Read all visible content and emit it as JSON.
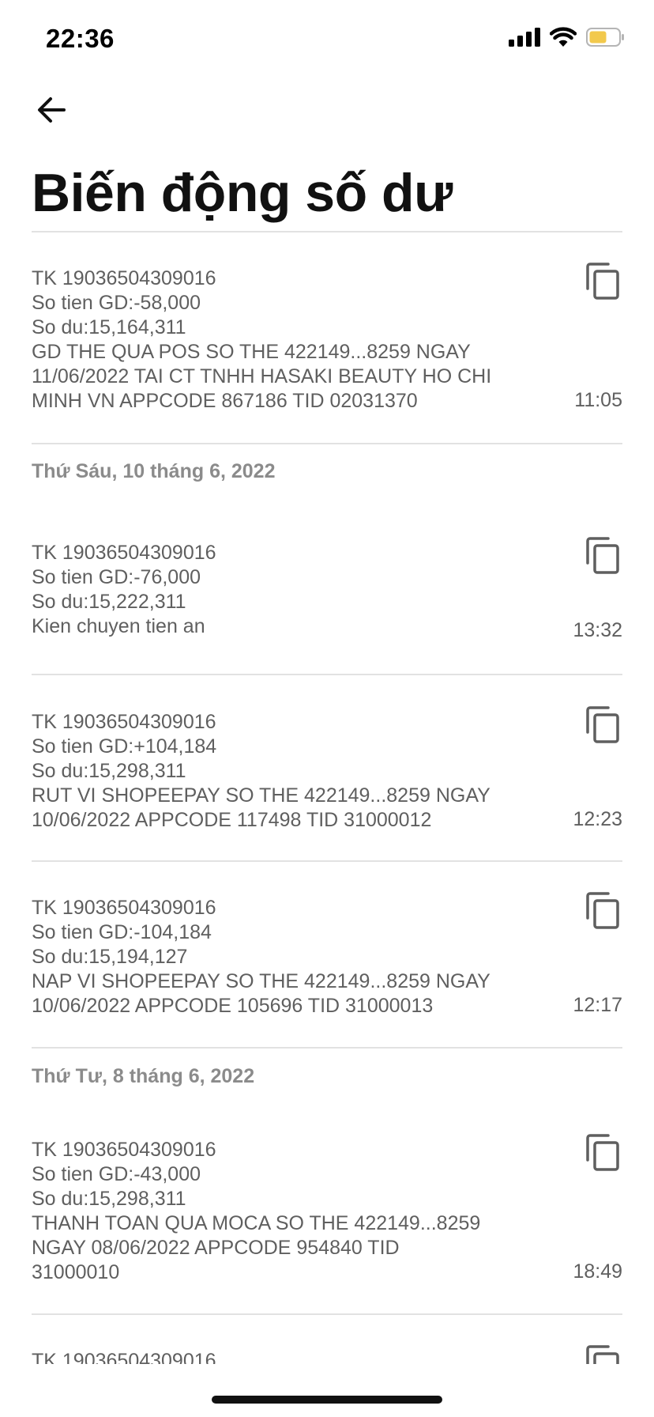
{
  "status_bar": {
    "time": "22:36",
    "battery_color": "#f2c94c"
  },
  "nav": {
    "back_icon": "arrow-left-icon"
  },
  "page": {
    "title": "Biến động số dư"
  },
  "colors": {
    "text": "#5f5f5f",
    "header": "#8b8b8b",
    "divider": "#e2e2e2"
  },
  "transactions": [
    {
      "lines": [
        "TK 19036504309016",
        "So tien GD:-58,000",
        "So du:15,164,311",
        "GD THE QUA POS SO THE 422149...8259 NGAY",
        "11/06/2022 TAI CT TNHH HASAKI BEAUTY HO CHI",
        "MINH VN APPCODE 867186 TID 02031370"
      ],
      "time": "11:05"
    },
    {
      "date_header": "Thứ Sáu, 10 tháng 6, 2022",
      "lines": [
        "TK 19036504309016",
        "So tien GD:-76,000",
        "So du:15,222,311",
        "Kien chuyen tien an"
      ],
      "time": "13:32"
    },
    {
      "lines": [
        "TK 19036504309016",
        "So tien GD:+104,184",
        "So du:15,298,311",
        "RUT VI SHOPEEPAY SO THE 422149...8259 NGAY",
        "10/06/2022 APPCODE 117498 TID 31000012"
      ],
      "time": "12:23"
    },
    {
      "lines": [
        "TK 19036504309016",
        "So tien GD:-104,184",
        "So du:15,194,127",
        "NAP VI SHOPEEPAY SO THE 422149...8259 NGAY",
        "10/06/2022 APPCODE 105696 TID 31000013"
      ],
      "time": "12:17"
    },
    {
      "date_header": "Thứ Tư, 8 tháng 6, 2022",
      "lines": [
        "TK 19036504309016",
        "So tien GD:-43,000",
        "So du:15,298,311",
        "THANH TOAN QUA MOCA SO THE 422149...8259",
        "NGAY 08/06/2022 APPCODE 954840 TID",
        "31000010"
      ],
      "time": "18:49"
    },
    {
      "lines": [
        "TK 19036504309016"
      ],
      "time": ""
    }
  ]
}
